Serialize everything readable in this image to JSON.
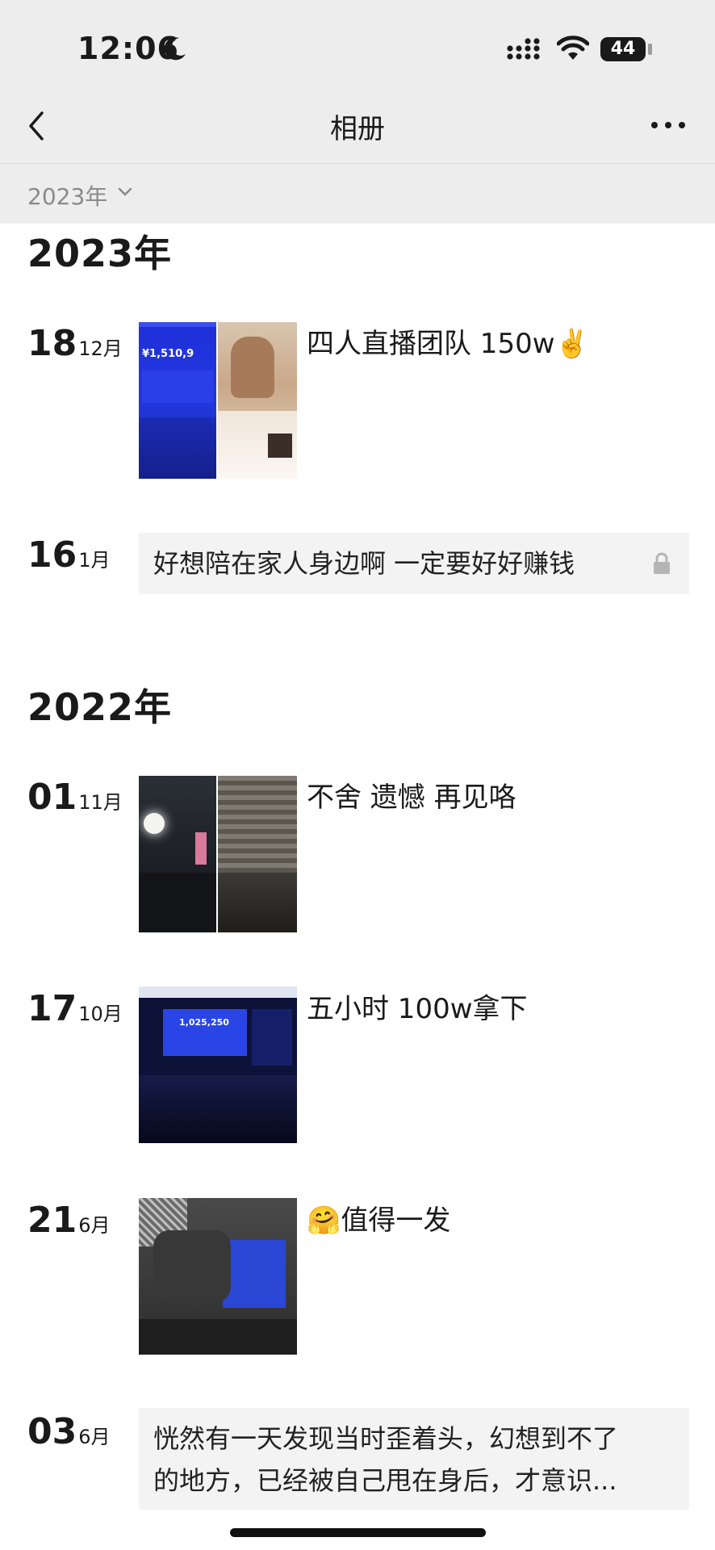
{
  "status_bar": {
    "time": "12:06",
    "battery": "44"
  },
  "nav": {
    "title": "相册"
  },
  "filter": {
    "label": "2023年"
  },
  "years": [
    "2023年",
    "2022年"
  ],
  "entries": [
    {
      "day": "18",
      "month": "12月",
      "type": "photos",
      "caption": "四人直播团队 150w✌️"
    },
    {
      "day": "16",
      "month": "1月",
      "type": "text",
      "text": "好想陪在家人身边啊 一定要好好赚钱",
      "private": true
    },
    {
      "day": "01",
      "month": "11月",
      "type": "photos",
      "caption": "不舍 遗憾 再见咯"
    },
    {
      "day": "17",
      "month": "10月",
      "type": "photo",
      "caption": "五小时 100w拿下"
    },
    {
      "day": "21",
      "month": "6月",
      "type": "photo",
      "caption": "🤗值得一发"
    },
    {
      "day": "03",
      "month": "6月",
      "type": "text",
      "text_line1": "恍然有一天发现当时歪着头，幻想到不了",
      "text_line2": "的地方，已经被自己甩在身后，才意识..."
    }
  ],
  "photo_texts": {
    "sales_figure": "¥1,510,9",
    "screen_figure": "1,025,250"
  },
  "colors": {
    "topbar": "#ededed",
    "card": "#f3f3f3",
    "muted": "#8a8a8a"
  }
}
